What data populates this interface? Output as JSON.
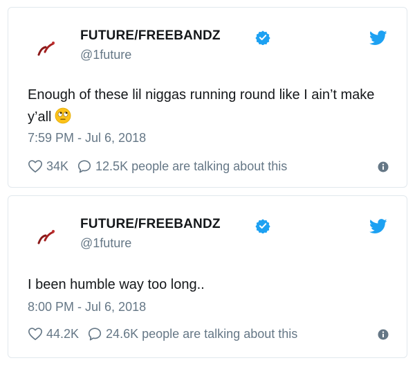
{
  "colors": {
    "twitter_blue": "#1da1f2",
    "muted": "#657786",
    "text": "#14171a",
    "border": "#e1e8ed"
  },
  "icons": [
    "avatar-icon",
    "verified-icon",
    "twitter-bird-icon",
    "heart-icon",
    "reply-bubble-icon",
    "info-icon",
    "eye-roll-emoji-icon"
  ],
  "tweets": [
    {
      "display_name": "FUTURE/FREEBANDZ",
      "handle": "@1future",
      "text": "Enough of these lil niggas running round like I ain’t make y’all",
      "timestamp": "7:59 PM - Jul 6, 2018",
      "likes": "34K",
      "talking": "12.5K people are talking about this"
    },
    {
      "display_name": "FUTURE/FREEBANDZ",
      "handle": "@1future",
      "text": "I been humble way too long..",
      "timestamp": "8:00 PM - Jul 6, 2018",
      "likes": "44.2K",
      "talking": "24.6K people are talking about this"
    }
  ]
}
